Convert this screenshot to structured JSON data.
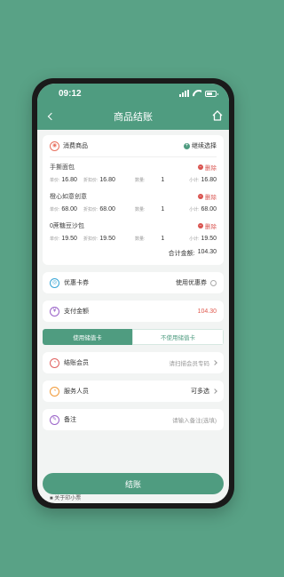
{
  "status": {
    "time": "09:12"
  },
  "nav": {
    "title": "商品结账"
  },
  "goods_card": {
    "title": "消费商品",
    "continue_label": "继续选择",
    "delete_label": "删除",
    "labels": {
      "price": "单价:",
      "discount": "折扣价:",
      "qty": "数量:",
      "subtotal": "小计:"
    },
    "items": [
      {
        "name": "手撕面包",
        "price": "16.80",
        "discount": "16.80",
        "qty": "1",
        "subtotal": "16.80"
      },
      {
        "name": "橙心如意创意",
        "price": "68.00",
        "discount": "68.00",
        "qty": "1",
        "subtotal": "68.00"
      },
      {
        "name": "0蔗糖豆沙包",
        "price": "19.50",
        "discount": "19.50",
        "qty": "1",
        "subtotal": "19.50"
      }
    ],
    "total_label": "合计金额:",
    "total_value": "104.30"
  },
  "coupon": {
    "label": "优惠卡券",
    "action": "使用优惠券"
  },
  "pay": {
    "label": "支付金额",
    "value": "104.30"
  },
  "stored_card": {
    "use": "使用储值卡",
    "not_use": "不使用储值卡"
  },
  "member": {
    "label": "结账会员",
    "hint": "请扫描会员专码"
  },
  "staff": {
    "label": "服务人员",
    "value": "可多选"
  },
  "remark": {
    "label": "备注",
    "placeholder": "请输入备注(选填)"
  },
  "checkout": {
    "label": "结账"
  },
  "partial": {
    "text": "■ 关于印小票"
  },
  "colors": {
    "primary": "#4f9c80",
    "background": "#59a286",
    "danger": "#d9534f",
    "amount": "#e05a4f"
  }
}
